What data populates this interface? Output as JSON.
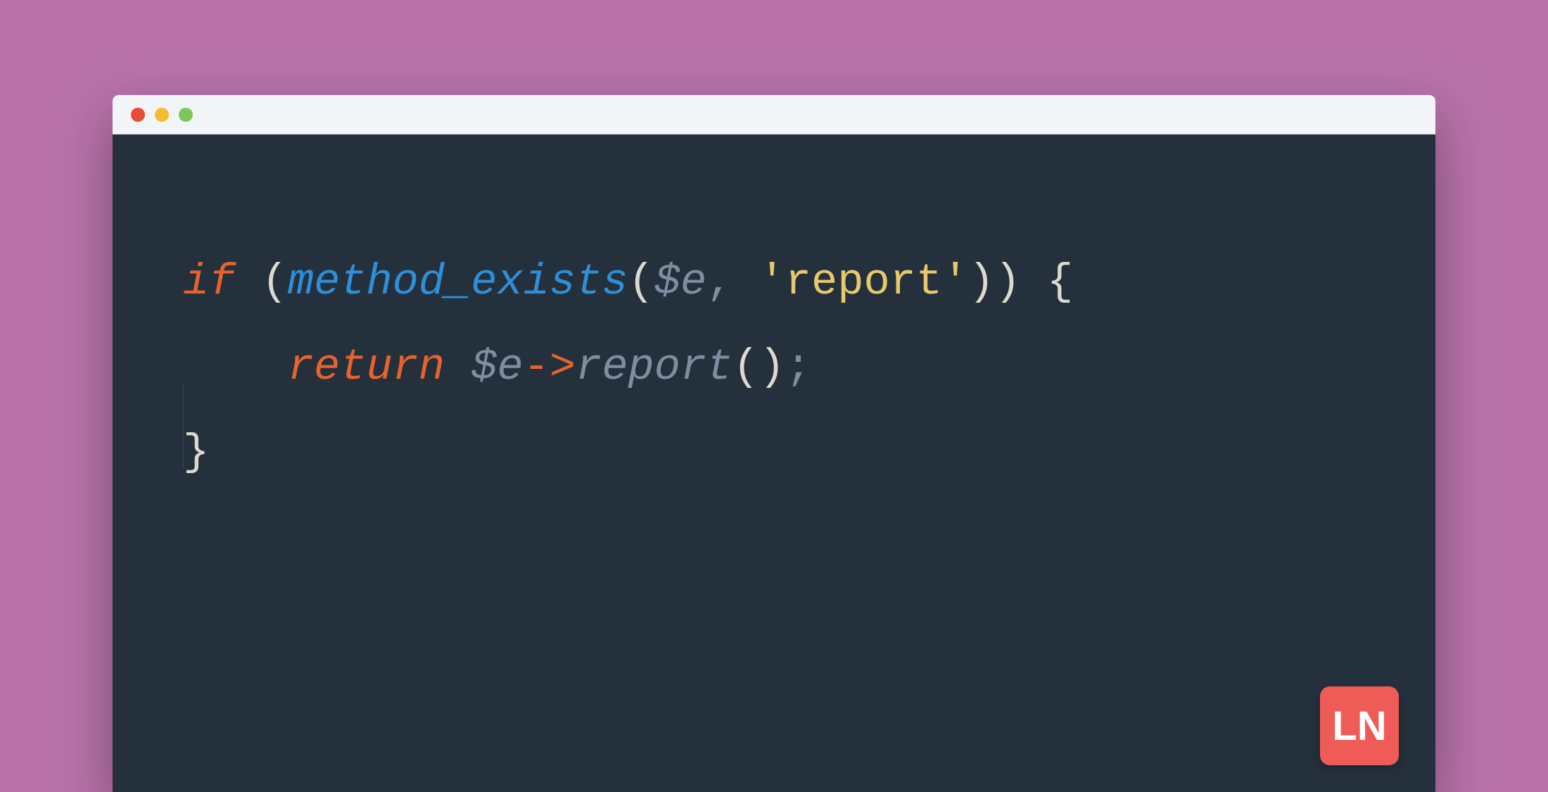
{
  "code": {
    "line1": {
      "if": "if",
      "func": "method_exists",
      "var": "$e",
      "comma": ",",
      "string": "'report'",
      "openParen": "(",
      "innerOpenParen": "(",
      "innerCloseParen": ")",
      "closeParen": ")",
      "openBrace": "{"
    },
    "line2": {
      "indent": "    ",
      "return": "return",
      "var": "$e",
      "arrow": "->",
      "method": "report",
      "openParen": "(",
      "closeParen": ")",
      "semi": ";"
    },
    "line3": {
      "closeBrace": "}"
    }
  },
  "badge": {
    "text": "LN"
  }
}
